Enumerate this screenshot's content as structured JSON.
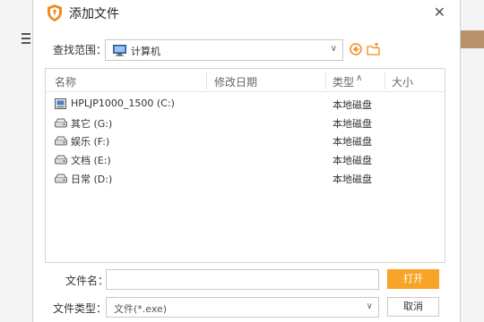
{
  "dialog": {
    "title": "添加文件",
    "close_glyph": "✕"
  },
  "look_in": {
    "label": "查找范围：",
    "value": "计算机",
    "icon": "computer-icon"
  },
  "nav": {
    "back_icon": "back-arrow-icon",
    "up_icon": "up-folder-icon"
  },
  "columns": {
    "name": "名称",
    "modified": "修改日期",
    "type": "类型",
    "size": "大小"
  },
  "rows": [
    {
      "name": "HPLJP1000_1500 (C:)",
      "type": "本地磁盘",
      "icon": "system-drive-icon"
    },
    {
      "name": "其它 (G:)",
      "type": "本地磁盘",
      "icon": "drive-icon"
    },
    {
      "name": "娱乐 (F:)",
      "type": "本地磁盘",
      "icon": "drive-icon"
    },
    {
      "name": "文档 (E:)",
      "type": "本地磁盘",
      "icon": "drive-icon"
    },
    {
      "name": "日常 (D:)",
      "type": "本地磁盘",
      "icon": "drive-icon"
    }
  ],
  "file_name": {
    "label": "文件名：",
    "value": ""
  },
  "file_type": {
    "label": "文件类型：",
    "value": "文件(*.exe)"
  },
  "buttons": {
    "open": "打开",
    "cancel": "取消"
  },
  "colors": {
    "accent": "#f7a428",
    "border": "#c8c8c8"
  }
}
